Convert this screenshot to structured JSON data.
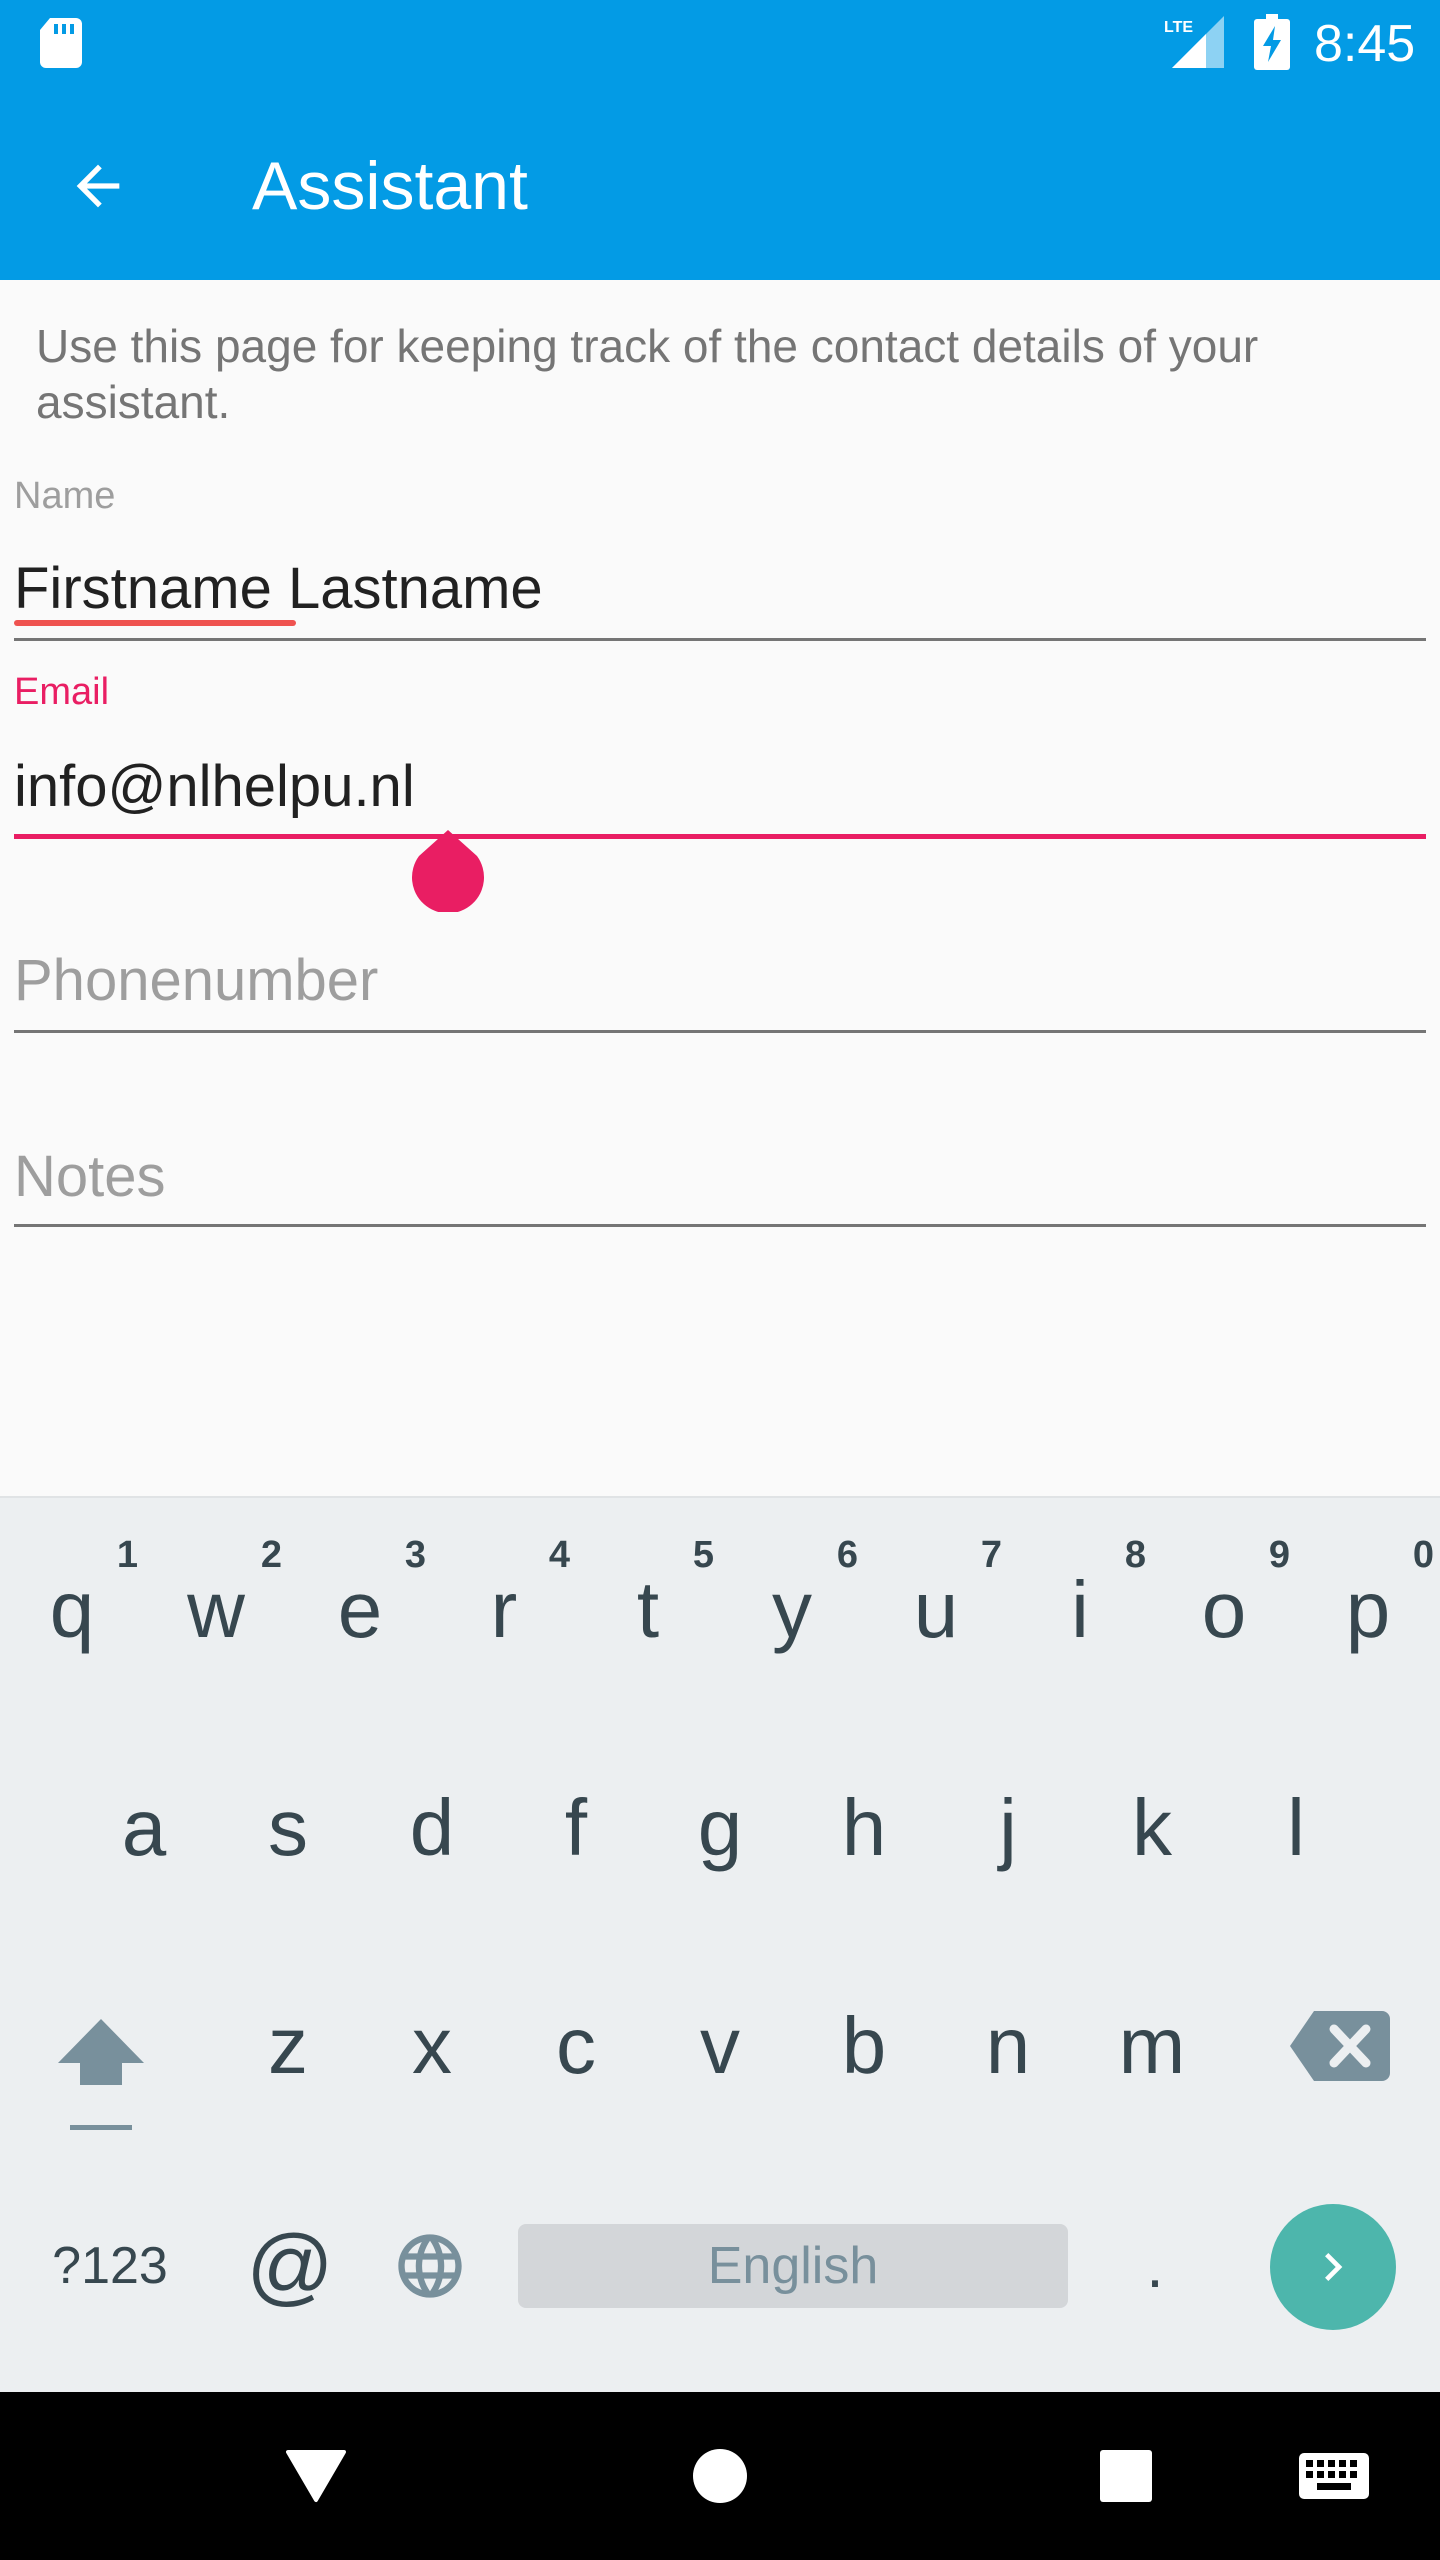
{
  "status_bar": {
    "time": "8:45",
    "network": "LTE",
    "icons": [
      "sd-card-icon",
      "lte-signal-icon",
      "battery-charging-icon"
    ]
  },
  "app_bar": {
    "title": "Assistant",
    "back_icon": "arrow-left-icon"
  },
  "intro_text": "Use this page for keeping track of the contact details of your assistant.",
  "form": {
    "name": {
      "label": "Name",
      "value": "Firstname Lastname"
    },
    "email": {
      "label": "Email",
      "value": "info@nlhelpu.nl",
      "focused": true
    },
    "phone": {
      "placeholder": "Phonenumber"
    },
    "notes": {
      "placeholder": "Notes"
    }
  },
  "keyboard": {
    "row1": [
      "q",
      "w",
      "e",
      "r",
      "t",
      "y",
      "u",
      "i",
      "o",
      "p"
    ],
    "row1_hints": [
      "1",
      "2",
      "3",
      "4",
      "5",
      "6",
      "7",
      "8",
      "9",
      "0"
    ],
    "row2": [
      "a",
      "s",
      "d",
      "f",
      "g",
      "h",
      "j",
      "k",
      "l"
    ],
    "row3": [
      "z",
      "x",
      "c",
      "v",
      "b",
      "n",
      "m"
    ],
    "symbols_label": "?123",
    "at_label": "@",
    "space_label": "English",
    "period_label": ".",
    "accent_color": "#4db6ac"
  },
  "colors": {
    "primary": "#039be5",
    "accent": "#e91e63"
  },
  "nav_bar": {
    "icons": [
      "back-triangle-icon",
      "home-circle-icon",
      "recents-square-icon",
      "keyboard-icon"
    ]
  }
}
